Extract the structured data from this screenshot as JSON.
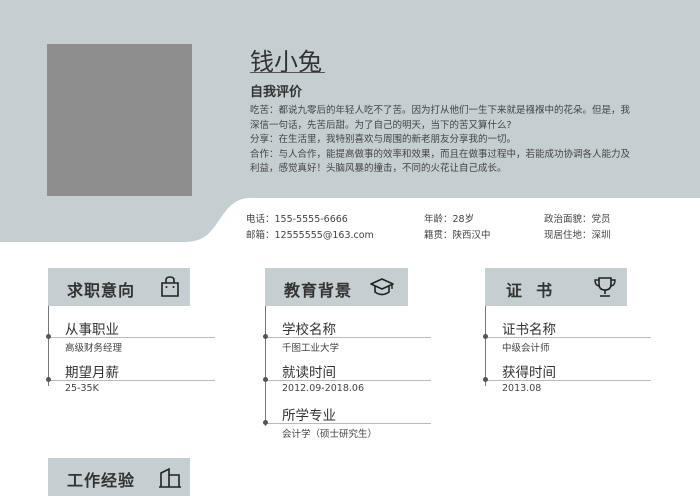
{
  "header": {
    "name": "钱小兔",
    "evaluation_title": "自我评价",
    "evaluation_lines": [
      "吃苦：都说九零后的年轻人吃不了苦。因为打从他们一生下来就是襁褓中的花朵。但是，我",
      "深信一句话，先苦后甜。为了自己的明天，当下的苦又算什么?",
      "分享：在生活里，我特别喜欢与周围的新老朋友分享我的一切。",
      "合作：与人合作，能提高做事的效率和效果，而且在做事过程中，若能成功协调各人能力及",
      "利益，感觉真好！头脑风暴的撞击，不同的火花让自己成长。"
    ],
    "colors": {
      "header_band": "#c5ced1",
      "photo_placeholder": "#8e8e8e"
    }
  },
  "contact": {
    "phone": "电话：155-5555-6666",
    "email": "邮箱：12555555@163.com",
    "age": "年龄：28岁",
    "hometown": "籍贯：陕西汉中",
    "politics": "政治面貌：党员",
    "residence": "现居住地：深圳"
  },
  "sections": {
    "job": {
      "title": "求职意向",
      "icon": "shopping-bag-icon",
      "items": [
        {
          "label": "从事职业",
          "value": "高级财务经理"
        },
        {
          "label": "期望月薪",
          "value": "25-35K"
        }
      ]
    },
    "education": {
      "title": "教育背景",
      "icon": "graduation-cap-icon",
      "items": [
        {
          "label": "学校名称",
          "value": "千图工业大学"
        },
        {
          "label": "就读时间",
          "value": "2012.09-2018.06"
        },
        {
          "label": "所学专业",
          "value": "会计学（硕士研究生）"
        }
      ]
    },
    "certificate": {
      "title": "证  书",
      "icon": "trophy-icon",
      "items": [
        {
          "label": "证书名称",
          "value": "中级会计师"
        },
        {
          "label": "获得时间",
          "value": "2013.08"
        }
      ]
    },
    "work": {
      "title": "工作经验",
      "icon": "building-icon"
    }
  }
}
